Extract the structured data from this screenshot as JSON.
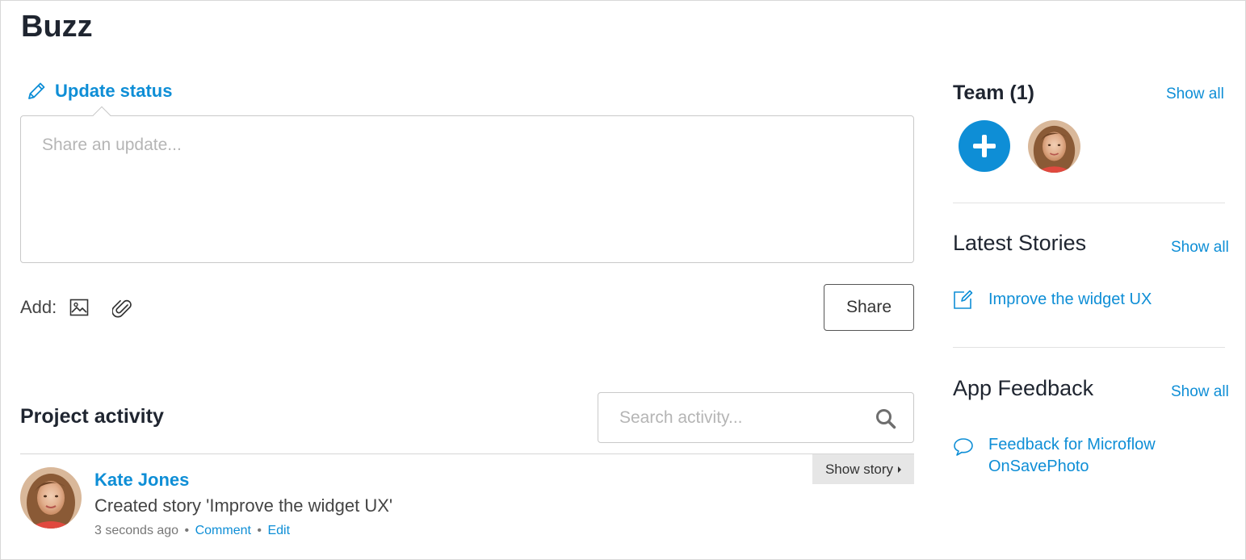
{
  "page": {
    "title": "Buzz"
  },
  "update_status": {
    "label": "Update status",
    "icon": "pencil-icon",
    "placeholder": "Share an update..."
  },
  "add_row": {
    "label": "Add:",
    "icons": [
      "image-icon",
      "paperclip-icon"
    ]
  },
  "share_button": {
    "label": "Share"
  },
  "activity": {
    "title": "Project activity",
    "search_placeholder": "Search activity...",
    "show_story_label": "Show story",
    "items": [
      {
        "author": "Kate Jones",
        "text": "Created story 'Improve the widget UX'",
        "time": "3 seconds ago",
        "comment_label": "Comment",
        "edit_label": "Edit",
        "separator": "•"
      }
    ]
  },
  "team": {
    "title": "Team (1)",
    "show_all": "Show all"
  },
  "latest_stories": {
    "title": "Latest Stories",
    "show_all": "Show all",
    "items": [
      {
        "label": "Improve the widget UX",
        "icon": "edit-note-icon"
      }
    ]
  },
  "app_feedback": {
    "title": "App Feedback",
    "show_all": "Show all",
    "items": [
      {
        "label": "Feedback for Microflow OnSavePhoto",
        "icon": "speech-bubble-icon"
      }
    ]
  },
  "colors": {
    "accent": "#0e8ed6",
    "heading": "#1f2530",
    "border": "#c9c9c9",
    "show_story_bg": "#e6e6e6"
  }
}
